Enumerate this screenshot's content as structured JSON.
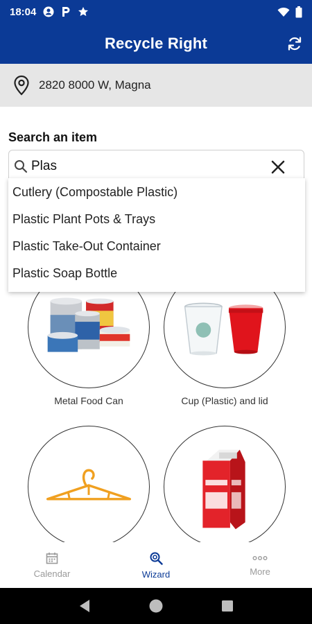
{
  "status_bar": {
    "time": "18:04",
    "icons": [
      "account-circle-icon",
      "parking-icon",
      "star-icon"
    ],
    "right_icons": [
      "wifi-icon",
      "battery-icon"
    ]
  },
  "app_bar": {
    "title": "Recycle Right",
    "refresh_icon": "refresh-icon"
  },
  "location": {
    "icon": "location-pin-icon",
    "address": "2820 8000 W, Magna"
  },
  "search": {
    "label": "Search an item",
    "value": "Plas",
    "suggestions": [
      "Cutlery (Compostable Plastic)",
      "Plastic Plant Pots & Trays",
      "Plastic Take-Out Container",
      "Plastic Soap Bottle"
    ]
  },
  "items": [
    {
      "label": "Metal Food Can",
      "icon": "metal-food-can-image"
    },
    {
      "label": "Cup (Plastic) and lid",
      "icon": "plastic-cup-image"
    },
    {
      "label": "",
      "icon": "clothes-hanger-image"
    },
    {
      "label": "",
      "icon": "milk-carton-image"
    }
  ],
  "bottom_nav": [
    {
      "label": "Calendar",
      "icon": "calendar-icon",
      "active": false
    },
    {
      "label": "Wizard",
      "icon": "wizard-icon",
      "active": true
    },
    {
      "label": "More",
      "icon": "more-icon",
      "active": false
    }
  ],
  "colors": {
    "primary": "#0b3a96",
    "location_bg": "#e6e6e6",
    "inactive": "#9a9a9a",
    "cup_red": "#e0141c"
  }
}
